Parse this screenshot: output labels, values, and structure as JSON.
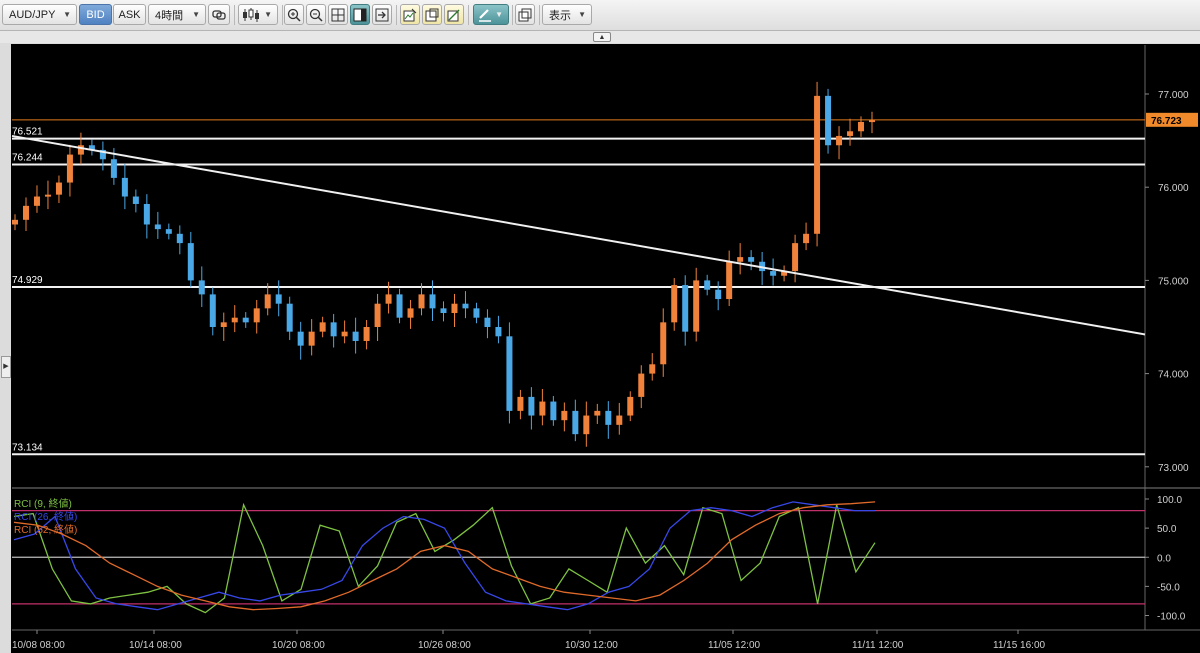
{
  "toolbar": {
    "symbol": "AUD/JPY",
    "bid_label": "BID",
    "ask_label": "ASK",
    "timeframe": "4時間",
    "display_label": "表示"
  },
  "chart_data": {
    "type": "candlestick",
    "symbol": "AUD/JPY",
    "timeframe": "4時間",
    "current_price": "76.723",
    "y_ticks": [
      "77.000",
      "76.000",
      "75.000",
      "74.000",
      "73.000"
    ],
    "x_ticks": [
      "10/08 08:00",
      "10/14 08:00",
      "10/20 08:00",
      "10/26 08:00",
      "10/30 12:00",
      "11/05 12:00",
      "11/11 12:00",
      "11/15 16:00"
    ],
    "horizontal_lines": [
      {
        "label": "76.521",
        "price": 76.521
      },
      {
        "label": "76.244",
        "price": 76.244
      },
      {
        "label": "74.929",
        "price": 74.929
      },
      {
        "label": "73.134",
        "price": 73.134
      }
    ],
    "trendline": {
      "start_price": 76.55,
      "end_price": 74.42
    },
    "price_path": [
      75.65,
      75.8,
      75.9,
      75.92,
      76.05,
      76.35,
      76.45,
      76.4,
      76.3,
      76.1,
      75.9,
      75.82,
      75.6,
      75.55,
      75.5,
      75.4,
      75.0,
      74.85,
      74.5,
      74.55,
      74.6,
      74.55,
      74.7,
      74.85,
      74.75,
      74.45,
      74.3,
      74.45,
      74.55,
      74.4,
      74.45,
      74.35,
      74.5,
      74.75,
      74.85,
      74.6,
      74.7,
      74.85,
      74.7,
      74.65,
      74.75,
      74.7,
      74.6,
      74.5,
      74.4,
      73.6,
      73.75,
      73.55,
      73.7,
      73.5,
      73.6,
      73.35,
      73.55,
      73.6,
      73.45,
      73.55,
      73.75,
      74.0,
      74.1,
      74.55,
      74.95,
      74.45,
      75.0,
      74.9,
      74.8,
      75.2,
      75.25,
      75.2,
      75.1,
      75.05,
      75.1,
      75.4,
      75.5,
      76.98,
      76.45,
      76.55,
      76.6,
      76.7,
      76.72
    ],
    "indicators": {
      "y_ticks": [
        "100.0",
        "50.0",
        "0.0",
        "-50.0",
        "-100.0"
      ],
      "reference_levels": [
        80,
        0,
        -80
      ],
      "series": [
        {
          "name": "RCI (9, 終値)",
          "color": "#7ec242",
          "values": [
            70,
            75,
            -20,
            -75,
            -80,
            -70,
            -65,
            -60,
            -50,
            -80,
            -95,
            -70,
            90,
            20,
            -75,
            -55,
            55,
            45,
            -50,
            -15,
            60,
            75,
            10,
            30,
            55,
            85,
            -15,
            -80,
            -70,
            -20,
            -40,
            -60,
            50,
            -10,
            20,
            -30,
            85,
            75,
            -40,
            -10,
            70,
            85,
            -80,
            90,
            -25,
            25
          ]
        },
        {
          "name": "RCI (26, 終値)",
          "color": "#3748e8",
          "values": [
            30,
            40,
            70,
            -20,
            -70,
            -80,
            -85,
            -90,
            -80,
            -70,
            -60,
            -70,
            -75,
            -65,
            -60,
            -55,
            -40,
            20,
            50,
            70,
            65,
            50,
            -10,
            -60,
            -75,
            -80,
            -85,
            -90,
            -80,
            -60,
            -50,
            -20,
            50,
            80,
            85,
            80,
            70,
            85,
            95,
            90,
            85,
            80,
            80
          ]
        },
        {
          "name": "RCI (52, 終値)",
          "color": "#e06a2a",
          "values": [
            60,
            55,
            40,
            20,
            -10,
            -30,
            -50,
            -65,
            -75,
            -85,
            -90,
            -88,
            -85,
            -75,
            -60,
            -40,
            -20,
            10,
            20,
            10,
            -20,
            -35,
            -50,
            -60,
            -65,
            -70,
            -75,
            -65,
            -40,
            -10,
            30,
            55,
            75,
            85,
            90,
            92,
            95
          ]
        }
      ]
    }
  }
}
